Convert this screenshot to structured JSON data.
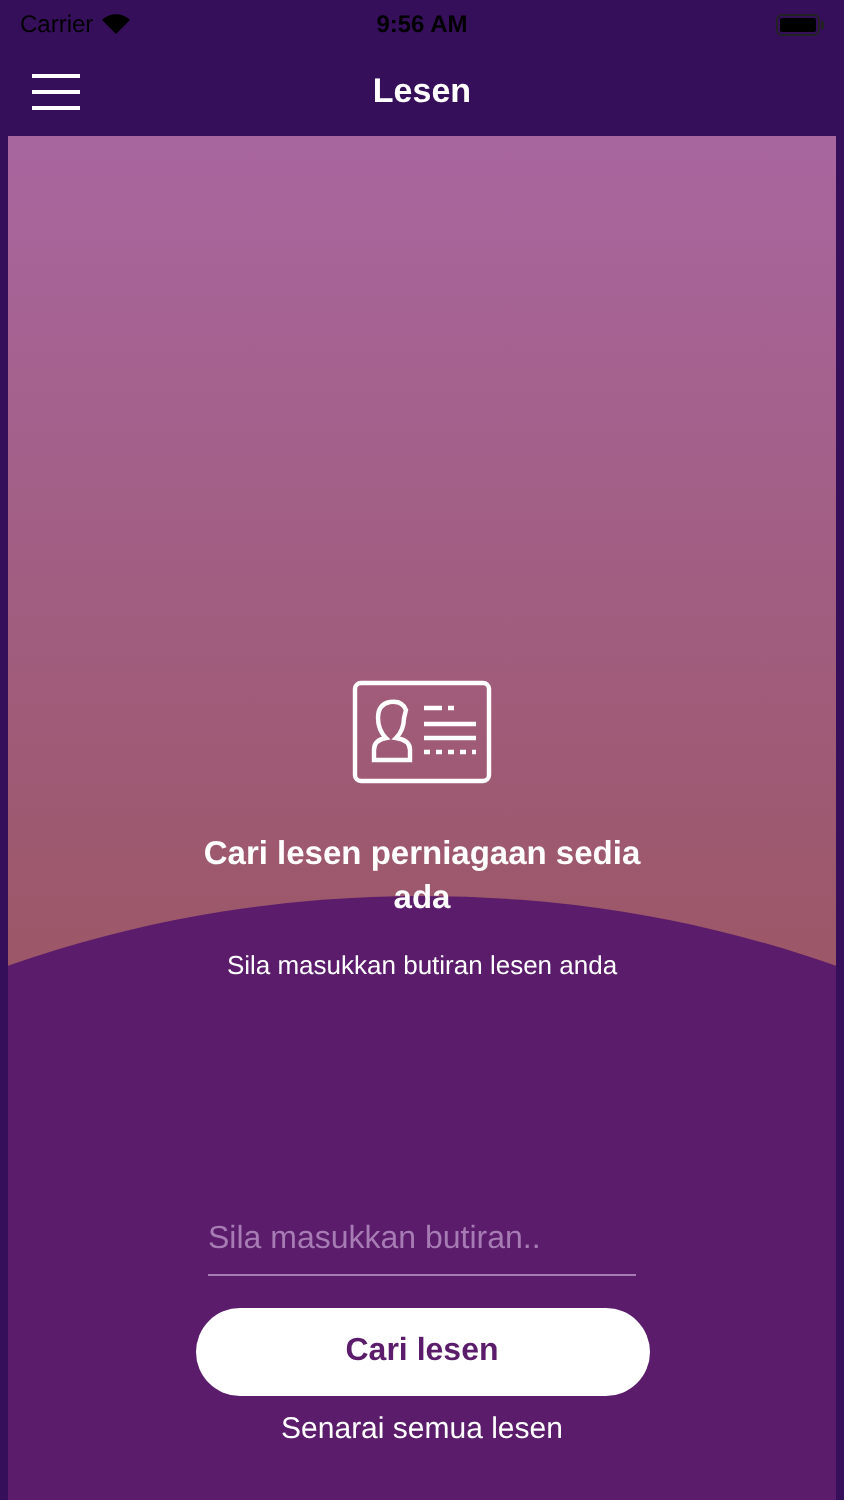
{
  "status_bar": {
    "carrier": "Carrier",
    "time": "9:56 AM"
  },
  "nav_bar": {
    "title": "Lesen"
  },
  "hero": {
    "title": "Cari lesen perniagaan sedia ada",
    "subtitle": "Sila masukkan butiran lesen anda"
  },
  "search": {
    "placeholder": "Sila masukkan butiran.."
  },
  "buttons": [
    {
      "kind": "primary",
      "label": "Cari lesen"
    },
    {
      "kind": "link",
      "label": "Senarai semua lesen"
    }
  ]
}
